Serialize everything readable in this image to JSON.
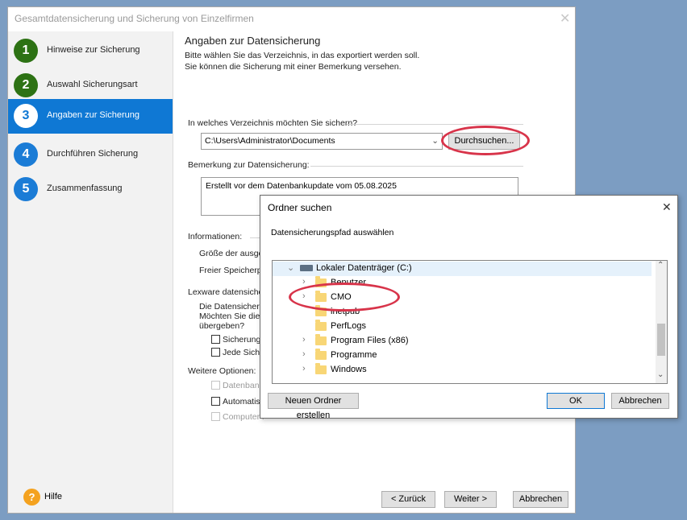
{
  "window": {
    "title": "Gesamtdatensicherung und Sicherung von Einzelfirmen",
    "close_glyph": "✕"
  },
  "steps": [
    {
      "number": "1",
      "label": "Hinweise zur Sicherung",
      "state": "done"
    },
    {
      "number": "2",
      "label": "Auswahl Sicherungsart",
      "state": "done"
    },
    {
      "number": "3",
      "label": "Angaben zur Sicherung",
      "state": "active"
    },
    {
      "number": "4",
      "label": "Durchführen Sicherung",
      "state": "todo"
    },
    {
      "number": "5",
      "label": "Zusammenfassung",
      "state": "todo"
    }
  ],
  "content": {
    "heading": "Angaben zur Datensicherung",
    "intro_line1": "Bitte wählen Sie das Verzeichnis, in das exportiert werden soll.",
    "intro_line2": "Sie können die Sicherung mit einer Bemerkung versehen.",
    "dir_question": "In welches Verzeichnis möchten Sie sichern?",
    "dir_value": "C:\\Users\\Administrator\\Documents",
    "browse_label": "Durchsuchen...",
    "remark_label": "Bemerkung zur Datensicherung:",
    "remark_value": "Erstellt vor dem Datenbankupdate vom 05.08.2025",
    "info_label": "Informationen:",
    "info_size": "Größe der ausgew",
    "info_free": "Freier Speicherpla",
    "lexware_label": "Lexware datensicher",
    "lexware_text1": "Die Datensicherun",
    "lexware_text2": "Möchten Sie die D",
    "lexware_text3": "übergeben?",
    "cb1_label": "Sicherung z",
    "cb2_label": "Jede Sicher",
    "more_options": "Weitere Optionen:",
    "opt1_label": "Datenbank",
    "opt2_label": "Automatisc",
    "opt3_label": "Computer r"
  },
  "footer": {
    "help_icon_glyph": "?",
    "help_label": "Hilfe",
    "back_label": "< Zurück",
    "next_label": "Weiter >",
    "cancel_label": "Abbrechen"
  },
  "dialog": {
    "title": "Ordner suchen",
    "close_glyph": "✕",
    "instruction": "Datensicherungspfad auswählen",
    "drive_label": "Lokaler Datenträger (C:)",
    "folders": [
      {
        "name": "Benutzer",
        "expandable": true
      },
      {
        "name": "CMO",
        "expandable": true
      },
      {
        "name": "inetpub",
        "expandable": false
      },
      {
        "name": "PerfLogs",
        "expandable": false
      },
      {
        "name": "Program Files (x86)",
        "expandable": true
      },
      {
        "name": "Programme",
        "expandable": true
      },
      {
        "name": "Windows",
        "expandable": true
      }
    ],
    "new_folder_label": "Neuen Ordner erstellen",
    "ok_label": "OK",
    "cancel_label": "Abbrechen"
  },
  "colors": {
    "accent": "#0f78d4",
    "done_step": "#2d7214",
    "highlight_ring": "#d8344a",
    "desktop": "#7c9dc2"
  }
}
